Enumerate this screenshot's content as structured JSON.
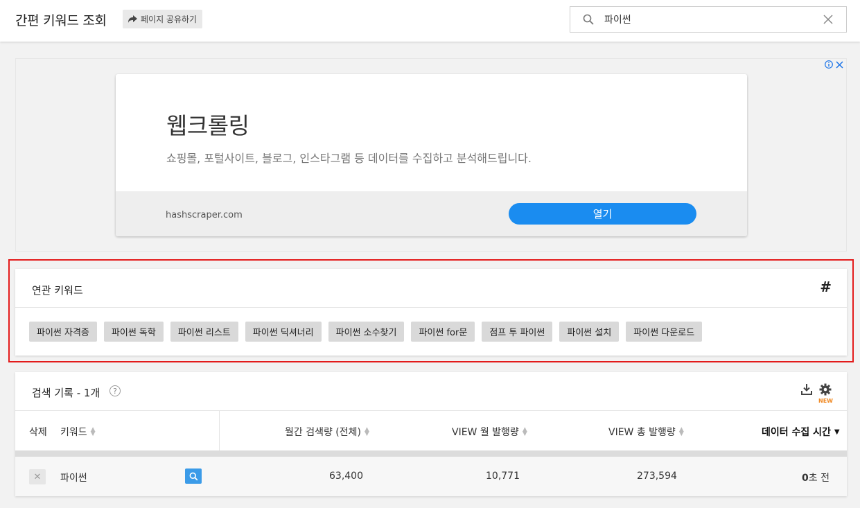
{
  "header": {
    "title": "간편 키워드 조회",
    "share_label": "페이지 공유하기",
    "search_value": "파이썬"
  },
  "ad": {
    "title": "웹크롤링",
    "description": "쇼핑몰, 포털사이트, 블로그, 인스타그램 등 데이터를 수집하고 분석해드립니다.",
    "url": "hashscraper.com",
    "open_label": "열기"
  },
  "related": {
    "title": "연관 키워드",
    "hash_symbol": "#",
    "tags": [
      "파이썬 자격증",
      "파이썬 독학",
      "파이썬 리스트",
      "파이썬 딕셔너리",
      "파이썬 소수찾기",
      "파이썬 for문",
      "점프 투 파이썬",
      "파이썬 설치",
      "파이썬 다운로드"
    ]
  },
  "history": {
    "title": "검색 기록 - 1개",
    "help_symbol": "?",
    "new_badge": "NEW",
    "columns": {
      "delete": "삭제",
      "keyword": "키워드",
      "monthly": "월간 검색량 (전체)",
      "view_month": "VIEW 월 발행량",
      "view_total": "VIEW 총 발행량",
      "time": "데이터 수집 시간"
    },
    "rows": [
      {
        "keyword": "파이썬",
        "monthly": "63,400",
        "view_month": "10,771",
        "view_total": "273,594",
        "time_num": "0",
        "time_unit": "초 전"
      }
    ]
  },
  "colors": {
    "accent": "#1a8cf0",
    "highlight": "#e31b1b",
    "new_badge": "#f08a24"
  }
}
